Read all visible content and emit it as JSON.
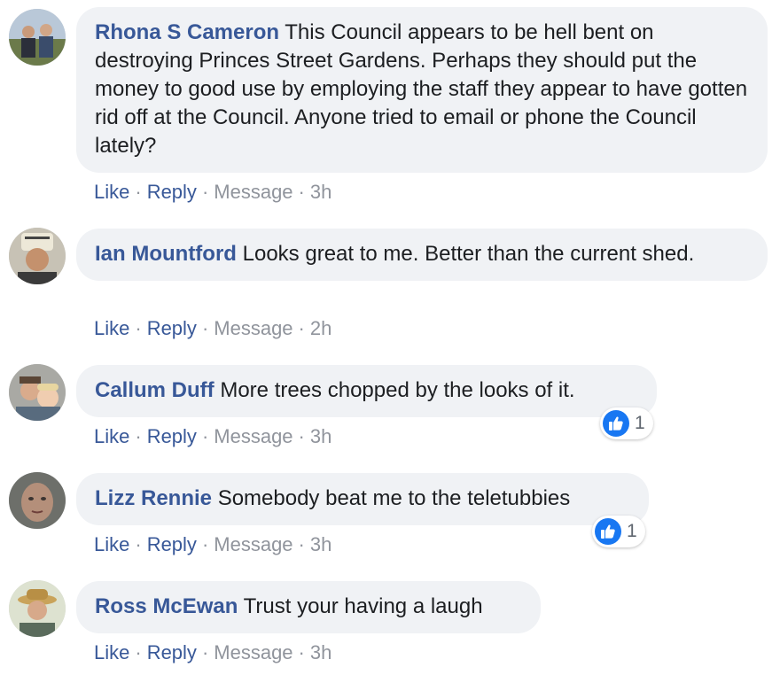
{
  "comments": [
    {
      "author": "Rhona S Cameron",
      "text": "This Council appears to be hell bent on destroying Princes Street Gardens. Perhaps they should put the money to good use by employing the staff they appear to have gotten rid off at the Council. Anyone tried to email or phone the Council lately?",
      "time": "3h"
    },
    {
      "author": "Ian Mountford",
      "text": "Looks great to me. Better than the current shed.",
      "time": "2h"
    },
    {
      "author": "Callum Duff",
      "text": "More trees chopped by the looks of it.",
      "time": "3h",
      "reactions": "1"
    },
    {
      "author": "Lizz Rennie",
      "text": "Somebody beat me to the teletubbies",
      "time": "3h",
      "reactions": "1"
    },
    {
      "author": "Ross McEwan",
      "text": "Trust your having a laugh",
      "time": "3h"
    }
  ],
  "actions": {
    "like": "Like",
    "reply": "Reply",
    "message": "Message",
    "dot": "·"
  },
  "icons": {
    "reaction": "like-icon"
  },
  "colors": {
    "link": "#385898",
    "bubble": "#f0f2f5",
    "meta": "#90949c",
    "like_blue": "#1877f2"
  }
}
